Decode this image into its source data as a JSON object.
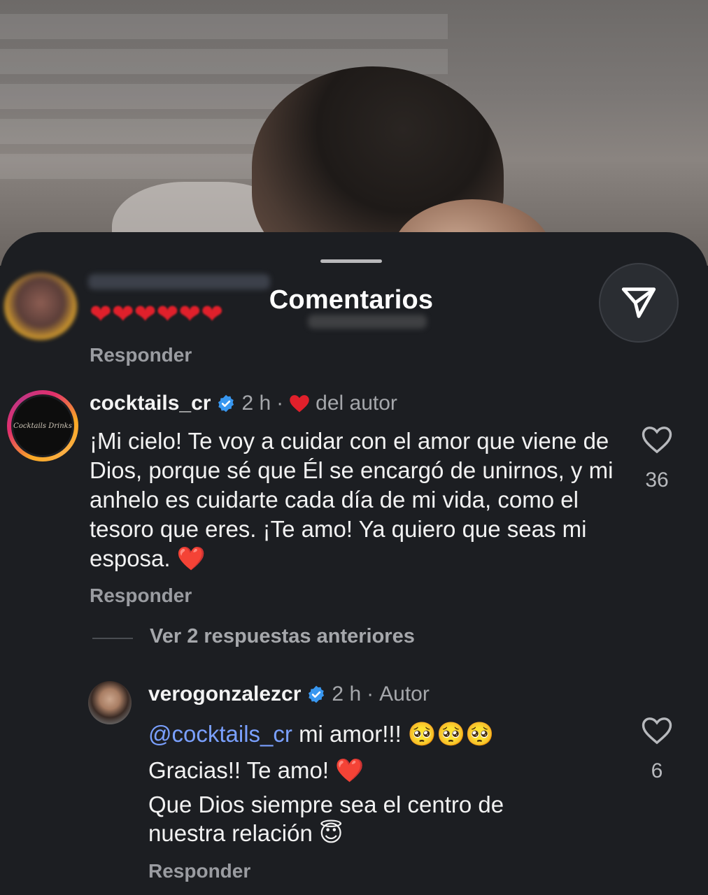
{
  "sheet": {
    "title": "Comentarios"
  },
  "previous_comment": {
    "content": "❤❤❤❤❤❤",
    "reply_label": "Responder"
  },
  "comments": [
    {
      "username": "cocktails_cr",
      "time": "2 h",
      "liked_by_author": "del autor",
      "text": "¡Mi cielo! Te voy a cuidar con el amor que viene de Dios, porque sé que Él se encargó de unirnos, y mi anhelo es cuidarte cada día de mi vida, como el tesoro que eres. ¡Te amo! Ya quiero que seas mi esposa. ❤️",
      "likes": "36",
      "reply_label": "Responder",
      "avatar_logo_text": "Cocktails Drinks"
    }
  ],
  "view_replies_label": "Ver 2 respuestas anteriores",
  "reply": {
    "username": "verogonzalezcr",
    "time": "2 h",
    "badge": "Autor",
    "mention": "@cocktails_cr",
    "line1_rest": "mi amor!!! 🥺🥺🥺",
    "line2": "Gracias!! Te amo! ❤️",
    "line3": "Que Dios siempre sea el centro de",
    "line4": "nuestra relación 😇",
    "likes": "6",
    "reply_label": "Responder"
  },
  "colors": {
    "background": "#1c1e22",
    "mention": "#7aa0ff",
    "verified": "#3897f0",
    "heart_red": "#e0202b",
    "muted_text": "#a5a7ab"
  },
  "icons": {
    "share": "paper-plane-icon",
    "like": "heart-outline-icon",
    "verified": "verified-badge-icon",
    "author_heart": "red-heart-icon"
  }
}
